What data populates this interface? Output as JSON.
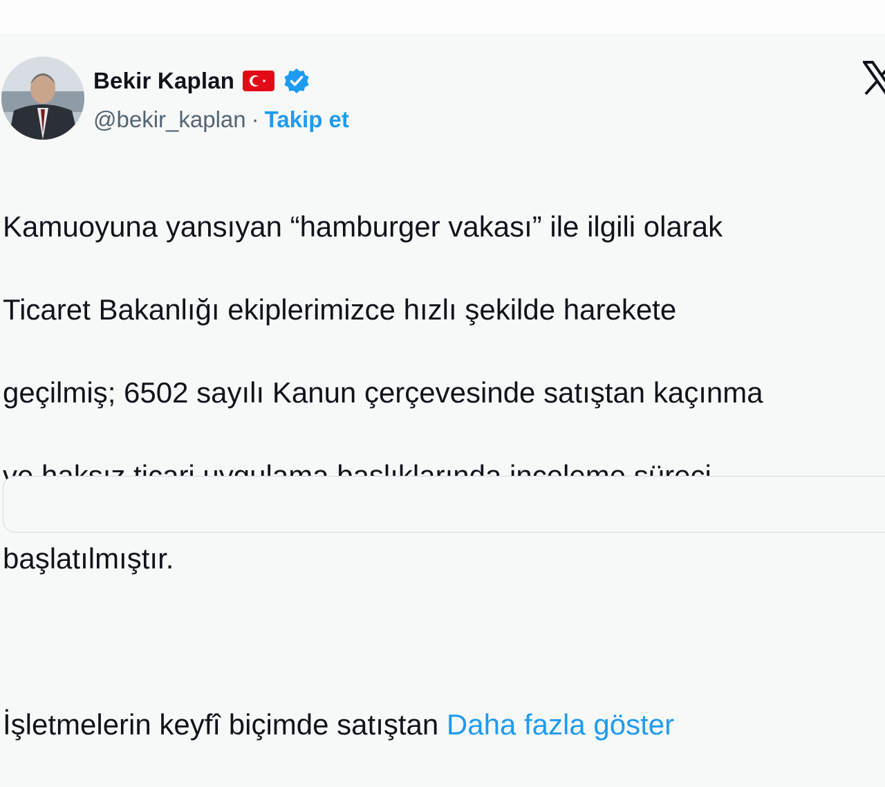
{
  "author": {
    "name": "Bekir Kaplan",
    "handle": "@bekir_kaplan",
    "separator": "·",
    "follow_label": "Takip et",
    "flag_icon": "turkey-flag-icon",
    "verified_icon": "verified-badge-icon"
  },
  "tweet": {
    "lines": [
      "Kamuoyuna yansıyan “hamburger vakası” ile ilgili olarak",
      "Ticaret Bakanlığı ekiplerimizce hızlı şekilde harekete",
      "geçilmiş; 6502 sayılı Kanun çerçevesinde satıştan kaçınma",
      "ve haksız ticari uygulama başlıklarında inceleme süreci",
      "başlatılmıştır."
    ],
    "second_paragraph": "İşletmelerin keyfî biçimde satıştan ",
    "show_more_label": "Daha fazla göster"
  },
  "colors": {
    "accent": "#1d9bf0",
    "text": "#0f1419",
    "muted": "#536471",
    "flag_red": "#e30a17"
  },
  "icons": {
    "platform_logo": "x-logo-icon"
  }
}
